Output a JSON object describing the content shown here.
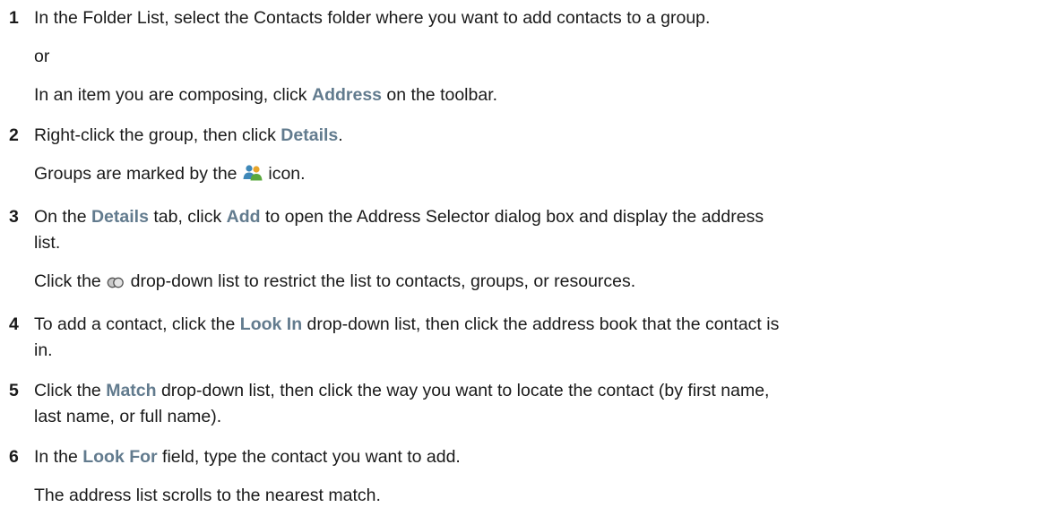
{
  "steps": [
    {
      "num": "1",
      "main": "In the Folder List, select the Contacts folder where you want to add contacts to a group.",
      "or": "or",
      "alt": {
        "pre": "In an item you are composing, click ",
        "ui": "Address",
        "post": " on the toolbar."
      }
    },
    {
      "num": "2",
      "main": {
        "pre": "Right-click the group, then click ",
        "ui": "Details",
        "post": "."
      },
      "note": {
        "pre": "Groups are marked by the ",
        "icon": "group-contacts-icon",
        "post": " icon."
      }
    },
    {
      "num": "3",
      "main": {
        "pre": "On the ",
        "ui1": "Details",
        "mid": " tab, click ",
        "ui2": "Add",
        "post1": " to open the Address Selector dialog box and display the address",
        "post2": "list."
      },
      "note": {
        "pre": "Click the ",
        "icon": "filter-circles-icon",
        "post": " drop-down list to restrict the list to contacts, groups, or resources."
      }
    },
    {
      "num": "4",
      "main": {
        "pre": "To add a contact, click the ",
        "ui": "Look In",
        "post1": " drop-down list, then click the address book that the contact is",
        "post2": "in."
      }
    },
    {
      "num": "5",
      "main": {
        "pre": "Click the ",
        "ui": "Match",
        "post1": " drop-down list, then click the way you want to locate the contact (by first name,",
        "post2": "last name, or full name)."
      }
    },
    {
      "num": "6",
      "main": {
        "pre": "In the ",
        "ui": "Look For",
        "post": " field, type the contact you want to add."
      },
      "note": "The address list scrolls to the nearest match."
    }
  ]
}
